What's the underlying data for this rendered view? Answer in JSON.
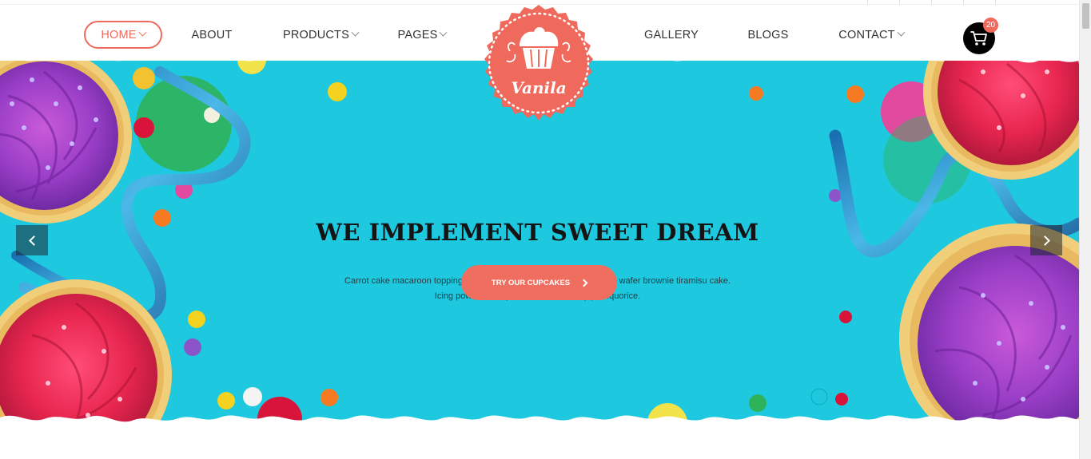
{
  "nav": {
    "items": [
      {
        "label": "HOME",
        "dropdown": true,
        "active": true
      },
      {
        "label": "ABOUT",
        "dropdown": false
      },
      {
        "label": "PRODUCTS",
        "dropdown": true
      },
      {
        "label": "PAGES",
        "dropdown": true
      },
      {
        "label": "GALLERY",
        "dropdown": false
      },
      {
        "label": "BLOGS",
        "dropdown": false
      },
      {
        "label": "CONTACT",
        "dropdown": true
      }
    ]
  },
  "logo": {
    "text": "Vanila",
    "icon": "cupcake-icon"
  },
  "cart": {
    "icon": "cart-icon",
    "count": "20"
  },
  "hero": {
    "title": "WE IMPLEMENT SWEET DREAM",
    "description_line1": "Carrot cake macaroon topping jelly-o dessert cake. Tiramisu gummies wafer brownie tiramisu cake.",
    "description_line2": "Icing powder candy canes cotton candy pie liquorice.",
    "cta_label": "TRY OUR CUPCAKES"
  },
  "colors": {
    "accent": "#ef6a5c",
    "hero_bg": "#1ec8df",
    "text_dark": "#141414"
  }
}
